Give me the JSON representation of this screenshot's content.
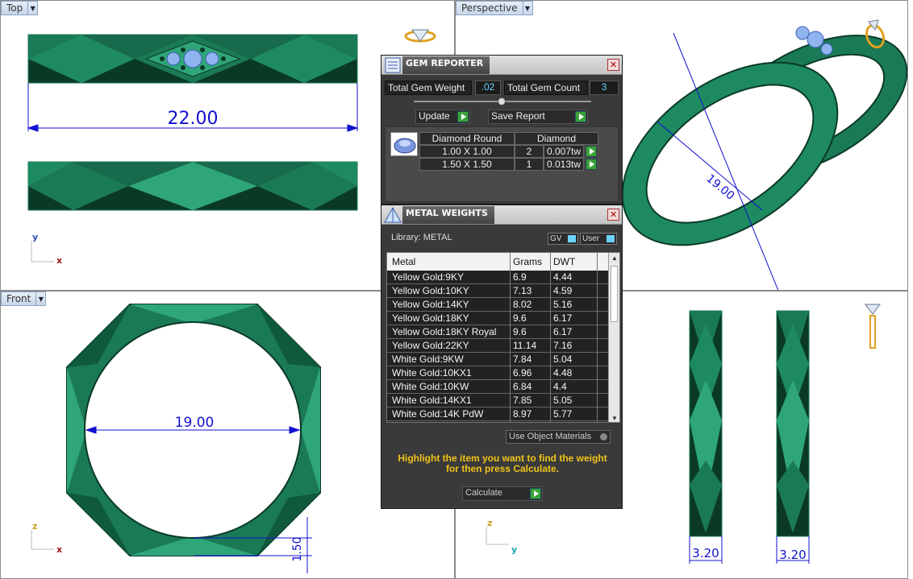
{
  "viewports": {
    "top": {
      "label": "Top",
      "dimension": "22.00",
      "axis_y": "y",
      "axis_x": "x"
    },
    "perspective": {
      "label": "Perspective",
      "dimension": "19.00"
    },
    "front": {
      "label": "Front",
      "dimension": "19.00",
      "small_dim": "1.50",
      "axis_y": "z",
      "axis_x": "x"
    },
    "right": {
      "label": "",
      "dim_left": "3.20",
      "dim_right": "3.20",
      "axis_y": "z",
      "axis_x": "y"
    }
  },
  "gem_reporter": {
    "title": "GEM REPORTER",
    "total_weight_label": "Total Gem Weight",
    "total_weight_value": ".02",
    "total_count_label": "Total Gem Count",
    "total_count_value": "3",
    "update_label": "Update",
    "save_report_label": "Save Report",
    "shape_header": "Diamond Round",
    "material_header": "Diamond",
    "rows": [
      {
        "size": "1.00 X 1.00",
        "count": "2",
        "weight": "0.007tw"
      },
      {
        "size": "1.50 X 1.50",
        "count": "1",
        "weight": "0.013tw"
      }
    ]
  },
  "metal_weights": {
    "title": "METAL WEIGHTS",
    "library_label": "Library: METAL",
    "gv_label": "GV",
    "user_label": "User",
    "columns": [
      "Metal",
      "Grams",
      "DWT"
    ],
    "rows": [
      {
        "metal": "Yellow Gold:9KY",
        "grams": "6.9",
        "dwt": "4.44"
      },
      {
        "metal": "Yellow Gold:10KY",
        "grams": "7.13",
        "dwt": "4.59"
      },
      {
        "metal": "Yellow Gold:14KY",
        "grams": "8.02",
        "dwt": "5.16"
      },
      {
        "metal": "Yellow Gold:18KY",
        "grams": "9.6",
        "dwt": "6.17"
      },
      {
        "metal": "Yellow Gold:18KY Royal",
        "grams": "9.6",
        "dwt": "6.17"
      },
      {
        "metal": "Yellow Gold:22KY",
        "grams": "11.14",
        "dwt": "7.16"
      },
      {
        "metal": "White Gold:9KW",
        "grams": "7.84",
        "dwt": "5.04"
      },
      {
        "metal": "White Gold:10KX1",
        "grams": "6.96",
        "dwt": "4.48"
      },
      {
        "metal": "White Gold:10KW",
        "grams": "6.84",
        "dwt": "4.4"
      },
      {
        "metal": "White Gold:14KX1",
        "grams": "7.85",
        "dwt": "5.05"
      },
      {
        "metal": "White Gold:14K PdW",
        "grams": "8.97",
        "dwt": "5.77"
      }
    ],
    "use_object_materials_label": "Use Object Materials",
    "hint": "Highlight the item you want to find the weight for then press Calculate.",
    "calculate_label": "Calculate"
  },
  "colors": {
    "ring_light": "#2fa57a",
    "ring_mid": "#1b7a56",
    "ring_dark": "#0a3a26",
    "dim_blue": "#1010d0",
    "hint_yellow": "#f0c418"
  }
}
